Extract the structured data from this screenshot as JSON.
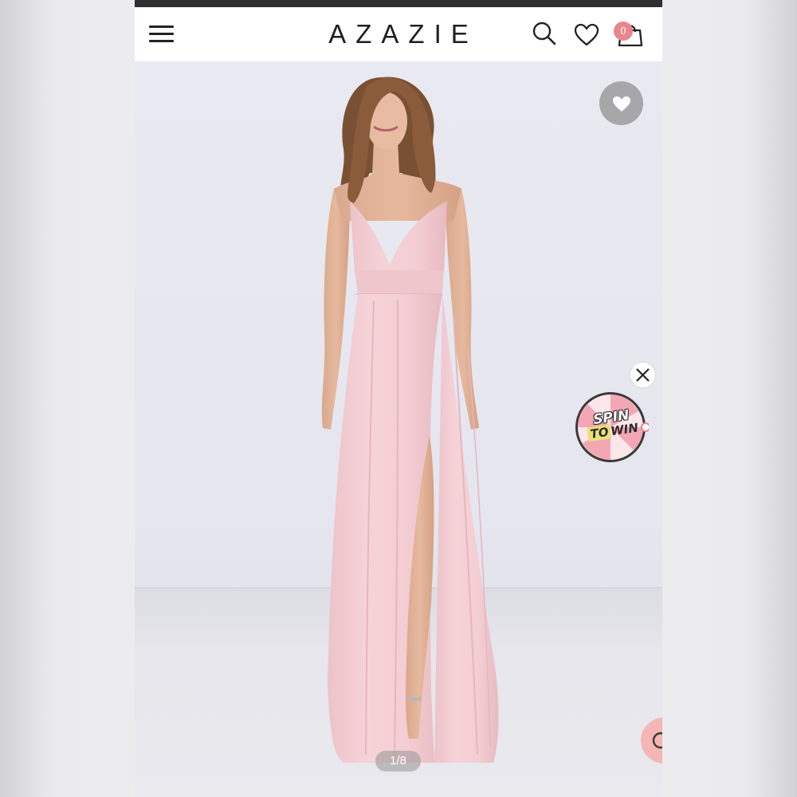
{
  "header": {
    "brand": "AZAZIE",
    "cart_count": "0",
    "icons": [
      "menu-icon",
      "search-icon",
      "heart-icon",
      "shopping-bag-icon"
    ]
  },
  "gallery": {
    "counter": "1/8",
    "favorite_icon": "heart-icon"
  },
  "promo": {
    "line1": "SPIN",
    "line2_a": "TO",
    "line2_b": "WIN",
    "close_icon": "close-icon"
  },
  "colors": {
    "badge": "#e7868c",
    "dress": "#f2ccd2",
    "header_bar": "#2f2f2f"
  }
}
